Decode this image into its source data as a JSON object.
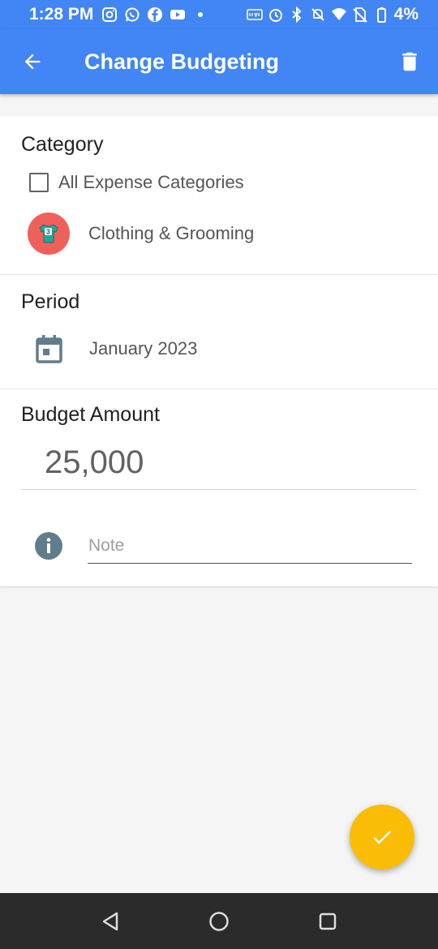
{
  "status_bar": {
    "time": "1:28 PM",
    "battery": "4%",
    "left_icons": [
      "instagram-icon",
      "whatsapp-icon",
      "facebook-icon",
      "youtube-icon",
      "dot-icon"
    ],
    "right_icons": [
      "volte-icon",
      "alarm-icon",
      "bluetooth-icon",
      "mute-icon",
      "wifi-icon",
      "no-sim-icon",
      "battery-icon"
    ]
  },
  "app_bar": {
    "title": "Change Budgeting",
    "back_icon": "arrow-back-icon",
    "action_icon": "trash-icon"
  },
  "category": {
    "title": "Category",
    "all_checkbox_label": "All Expense Categories",
    "all_checked": false,
    "selected_label": "Clothing & Grooming",
    "selected_icon": "shirt-icon"
  },
  "period": {
    "title": "Period",
    "value": "January 2023",
    "icon": "calendar-icon"
  },
  "budget": {
    "title": "Budget Amount",
    "amount": "25,000"
  },
  "note": {
    "placeholder": "Note",
    "value": "",
    "icon": "info-icon"
  },
  "fab": {
    "icon": "check-icon"
  },
  "nav_bar": {
    "icons": [
      "back-triangle-icon",
      "home-circle-icon",
      "recents-square-icon"
    ]
  },
  "colors": {
    "primary": "#4285f4",
    "fab": "#fbbc05",
    "category_avatar": "#f0605a",
    "icon_grey": "#607d8b",
    "nav_bar": "#2b2b2b"
  }
}
